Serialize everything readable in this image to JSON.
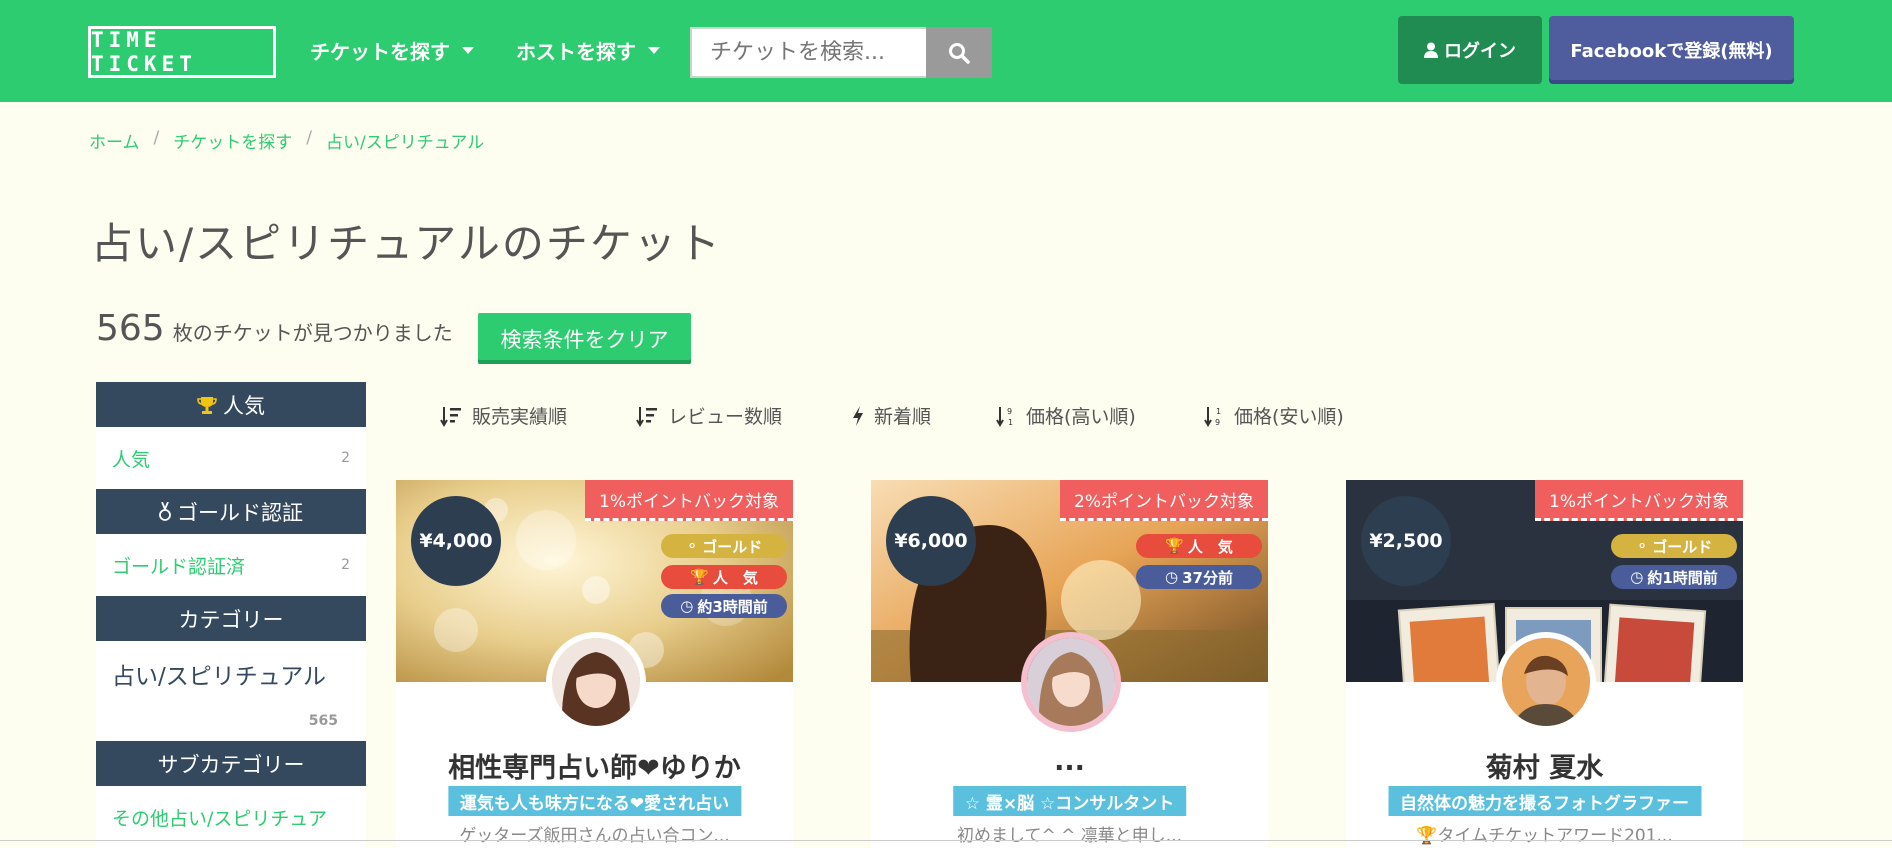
{
  "header": {
    "logo": "TIME TICKET",
    "nav": [
      "チケットを探す",
      "ホストを探す"
    ],
    "search_placeholder": "チケットを検索...",
    "login_label": "ログイン",
    "facebook_label": "Facebookで登録(無料)",
    "colors": {
      "brand": "#2ecc71",
      "facebook": "#4f5c9e"
    }
  },
  "breadcrumb": [
    "ホーム",
    "チケットを探す",
    "占い/スピリチュアル"
  ],
  "page_title": "占い/スピリチュアルのチケット",
  "result": {
    "count": "565",
    "suffix": "枚のチケットが見つかりました",
    "clear_label": "検索条件をクリア"
  },
  "sidebar": {
    "popular_head": "人気",
    "popular_item": {
      "label": "人気",
      "count": "2"
    },
    "gold_head": "ゴールド認証",
    "gold_item": {
      "label": "ゴールド認証済",
      "count": "2"
    },
    "category_head": "カテゴリー",
    "category_item": {
      "label": "占い/スピリチュアル",
      "count": "565"
    },
    "subcategory_head": "サブカテゴリー",
    "subcategory_item": {
      "label": "その他占い/スピリチュア"
    }
  },
  "sort": [
    "販売実績順",
    "レビュー数順",
    "新着順",
    "価格(高い順)",
    "価格(安い順)"
  ],
  "cards": [
    {
      "pointback": "1%ポイントバック対象",
      "price": "¥4,000",
      "badges": [
        "ゴールド",
        "人　気",
        "約3時間前"
      ],
      "name": "相性専門占い師❤ゆりか",
      "tagline": "運気も人も味方になる❤愛され占い",
      "desc": "ゲッターズ飯田さんの占い合コン..."
    },
    {
      "pointback": "2%ポイントバック対象",
      "price": "¥6,000",
      "badges": [
        "人　気",
        "37分前"
      ],
      "name": "...",
      "tagline": "☆ 霊×脳 ☆コンサルタント",
      "desc": "初めまして^ ^ 凛華と申し..."
    },
    {
      "pointback": "1%ポイントバック対象",
      "price": "¥2,500",
      "badges": [
        "ゴールド",
        "約1時間前"
      ],
      "name": "菊村 夏水",
      "tagline": "自然体の魅力を撮るフォトグラファー",
      "desc": "タイムチケットアワード201..."
    }
  ]
}
